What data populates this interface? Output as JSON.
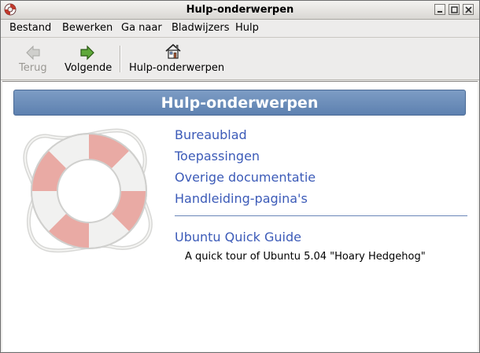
{
  "window": {
    "title": "Hulp-onderwerpen"
  },
  "menu": [
    "Bestand",
    "Bewerken",
    "Ga naar",
    "Bladwijzers",
    "Hulp"
  ],
  "toolbar": {
    "back_label": "Terug",
    "forward_label": "Volgende",
    "home_label": "Hulp-onderwerpen"
  },
  "content": {
    "heading": "Hulp-onderwerpen",
    "topics": [
      "Bureaublad",
      "Toepassingen",
      "Overige documentatie",
      "Handleiding-pagina's"
    ],
    "guide_link": "Ubuntu Quick Guide",
    "guide_description": "A quick tour of Ubuntu 5.04 \"Hoary Hedgehog\""
  },
  "colors": {
    "link": "#3c5bb8",
    "header_bg": "#6b8dba",
    "buoy_stripe": "#e9aaa4"
  },
  "icons": [
    "help-app-icon",
    "minimize-icon",
    "maximize-icon",
    "close-icon",
    "back-arrow-icon",
    "forward-arrow-icon",
    "home-icon",
    "lifebuoy-icon"
  ]
}
